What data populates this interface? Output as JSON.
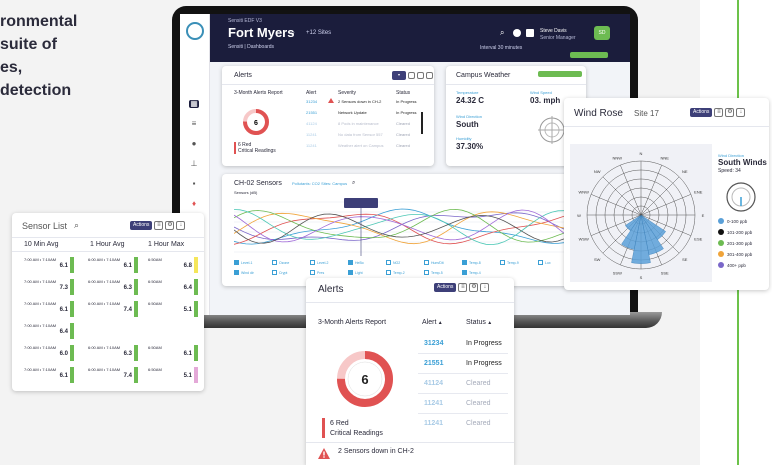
{
  "hero": {
    "lines": [
      "ronmental",
      "suite of",
      "es,",
      "detection"
    ]
  },
  "dashboard": {
    "campus_label": "Sensiti EDF V3",
    "city": "Fort Myers",
    "sites": "+12 Sites",
    "breadcrumb": "Sensiti | Dashboards",
    "user_name": "Steve Davis",
    "user_role": "Senior Manager",
    "user_initials": "SD",
    "meta": "Interval 30 minutes",
    "alerts_card": {
      "title": "Alerts",
      "report": "3-Month Alerts Report",
      "cols": [
        "Alert",
        "Severity",
        "Status"
      ],
      "rows": [
        {
          "id": "31234",
          "severity": "2 Sensors down in CH-2",
          "status": "In Progress"
        },
        {
          "id": "21551",
          "severity": "Network Update",
          "status": "In Progress"
        },
        {
          "id": "41124",
          "severity": "8 Pods in maintenance",
          "status": "Cleared"
        },
        {
          "id": "11241",
          "severity": "No data from Sensor 557",
          "status": "Cleared"
        },
        {
          "id": "11241",
          "severity": "Weather alert on Campus",
          "status": "Cleared"
        }
      ],
      "count": "6",
      "red_label": "6 Red",
      "critical_label": "Critical Readings"
    },
    "weather": {
      "title": "Campus Weather",
      "temp_label": "Temperature",
      "temp_value": "24.32 C",
      "wind_speed_label": "Wind Speed",
      "wind_speed_value": "03. mph",
      "wind_dir_label": "Wind Direction",
      "wind_dir_value": "South",
      "humidity_label": "Humidity",
      "humidity_value": "37.30%"
    },
    "sensors": {
      "title": "CH-02 Sensors",
      "filters": "Pollutants: CO2 Sites: Campus",
      "unit": "Sensors (dB)",
      "legend": [
        "Level-1",
        "Ozone",
        "Level-2",
        "HeBo",
        "NO2",
        "Hum/Dit",
        "Temp-8",
        "Temp-9",
        "Lux",
        "Wind dir",
        "Crypt",
        "Pres",
        "Light",
        "Temp-2",
        "Temp-5",
        "Temp-4"
      ]
    }
  },
  "sensor_list": {
    "title": "Sensor List",
    "cols": [
      "10 Min Avg",
      "1 Hour Avg",
      "1 Hour Max"
    ],
    "actions": "Actions",
    "rows": [
      [
        {
          "t": "7:00 AM • 7:10AM",
          "v": "6.1",
          "c": "#6dbb52"
        },
        {
          "t": "6:00 AM • 7:10AM",
          "v": "6.1",
          "c": "#6dbb52"
        },
        {
          "t": "6:50AM",
          "v": "6.8",
          "c": "#f5e65a"
        }
      ],
      [
        {
          "t": "7:00 AM • 7:10AM",
          "v": "7.3",
          "c": "#6dbb52"
        },
        {
          "t": "6:00 AM • 7:10AM",
          "v": "6.3",
          "c": "#6dbb52"
        },
        {
          "t": "6:50AM",
          "v": "6.4",
          "c": "#6dbb52"
        }
      ],
      [
        {
          "t": "7:00 AM • 7:10AM",
          "v": "6.1",
          "c": "#6dbb52"
        },
        {
          "t": "6:00 AM • 7:10AM",
          "v": "7.4",
          "c": "#6dbb52"
        },
        {
          "t": "6:50AM",
          "v": "5.1",
          "c": "#6dbb52"
        }
      ],
      [
        {
          "t": "7:00 AM • 7:10AM",
          "v": "6.4",
          "c": "#6dbb52"
        },
        {
          "t": "",
          "v": "",
          "c": ""
        },
        {
          "t": "",
          "v": "",
          "c": ""
        }
      ],
      [
        {
          "t": "7:00 AM • 7:10AM",
          "v": "6.0",
          "c": "#6dbb52"
        },
        {
          "t": "6:00 AM • 7:10AM",
          "v": "6.3",
          "c": "#6dbb52"
        },
        {
          "t": "6:50AM",
          "v": "6.1",
          "c": "#6dbb52"
        }
      ],
      [
        {
          "t": "7:00 AM • 7:10AM",
          "v": "6.1",
          "c": "#6dbb52"
        },
        {
          "t": "6:00 AM • 7:10AM",
          "v": "7.4",
          "c": "#6dbb52"
        },
        {
          "t": "6:50AM",
          "v": "5.1",
          "c": "#e4a9d8"
        }
      ]
    ]
  },
  "wind_rose": {
    "title": "Wind Rose",
    "site": "Site 17",
    "actions": "Actions",
    "dirs": [
      "N",
      "NNE",
      "NE",
      "ENE",
      "E",
      "ESE",
      "SE",
      "SSE",
      "S",
      "SSW",
      "SW",
      "WSW",
      "W",
      "WNW",
      "NW",
      "NNW"
    ],
    "wind_direction_label": "Wind Direction",
    "wind_direction_value": "South Winds",
    "speed_label": "Speed: 34",
    "legend": [
      {
        "label": "0-100 ppb",
        "color": "#5aa0d8"
      },
      {
        "label": "101-200 ppb",
        "color": "#111111"
      },
      {
        "label": "201-300 ppb",
        "color": "#6dbb52"
      },
      {
        "label": "301-400 ppb",
        "color": "#f0a43a"
      },
      {
        "label": "400+ ppb",
        "color": "#7a67c9"
      }
    ],
    "petals": [
      0,
      0,
      0,
      0,
      0,
      0,
      0.55,
      0.75,
      0.9,
      0.65,
      0.35,
      0,
      0,
      0,
      0,
      0
    ]
  },
  "alerts_popup": {
    "title": "Alerts",
    "actions": "Actions",
    "report": "3-Month Alerts Report",
    "alert_col": "Alert",
    "status_col": "Status",
    "rows": [
      {
        "id": "31234",
        "status": "In Progress",
        "kind": "progress"
      },
      {
        "id": "21551",
        "status": "In Progress",
        "kind": "progress"
      },
      {
        "id": "41124",
        "status": "Cleared",
        "kind": "cleared"
      },
      {
        "id": "11241",
        "status": "Cleared",
        "kind": "cleared"
      },
      {
        "id": "11241",
        "status": "Cleared",
        "kind": "cleared"
      }
    ],
    "count": "6",
    "red_label": "6 Red",
    "critical_label": "Critical Readings",
    "warning": "2 Sensors down in CH-2",
    "ring_fraction": 0.75
  }
}
